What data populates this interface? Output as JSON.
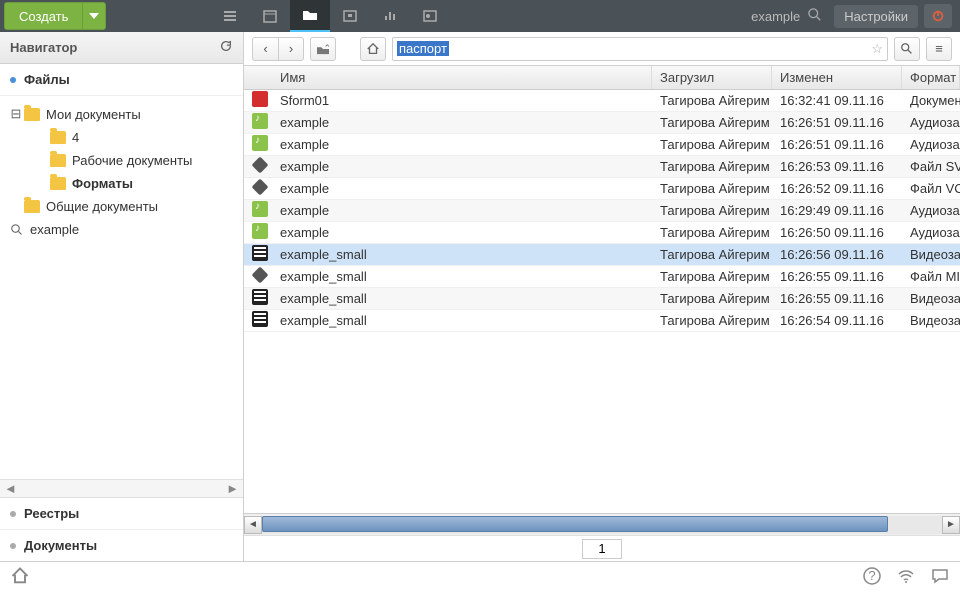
{
  "header": {
    "create_label": "Создать",
    "search_text": "example",
    "settings_label": "Настройки"
  },
  "sidebar": {
    "title": "Навигатор",
    "files_label": "Файлы",
    "tree": {
      "my_docs": "Мои документы",
      "item_4": "4",
      "working_docs": "Рабочие документы",
      "formats": "Форматы",
      "shared_docs": "Общие документы",
      "search_example": "example"
    },
    "registries_label": "Реестры",
    "documents_label": "Документы"
  },
  "toolbar": {
    "path_text": "паспорт"
  },
  "table": {
    "headers": {
      "name": "Имя",
      "uploader": "Загрузил",
      "modified": "Изменен",
      "type": "Формат"
    },
    "rows": [
      {
        "icon": "pdf",
        "name": "Sform01",
        "uploader": "Тагирова Айгерим",
        "modified": "16:32:41 09.11.16",
        "type": "Докумен",
        "selected": false
      },
      {
        "icon": "audio",
        "name": "example",
        "uploader": "Тагирова Айгерим",
        "modified": "16:26:51 09.11.16",
        "type": "Аудиоза",
        "selected": false
      },
      {
        "icon": "audio",
        "name": "example",
        "uploader": "Тагирова Айгерим",
        "modified": "16:26:51 09.11.16",
        "type": "Аудиоза",
        "selected": false
      },
      {
        "icon": "3d",
        "name": "example",
        "uploader": "Тагирова Айгерим",
        "modified": "16:26:53 09.11.16",
        "type": "Файл SV",
        "selected": false
      },
      {
        "icon": "3d",
        "name": "example",
        "uploader": "Тагирова Айгерим",
        "modified": "16:26:52 09.11.16",
        "type": "Файл VC",
        "selected": false
      },
      {
        "icon": "audio",
        "name": "example",
        "uploader": "Тагирова Айгерим",
        "modified": "16:29:49 09.11.16",
        "type": "Аудиоза",
        "selected": false
      },
      {
        "icon": "audio",
        "name": "example",
        "uploader": "Тагирова Айгерим",
        "modified": "16:26:50 09.11.16",
        "type": "Аудиоза",
        "selected": false
      },
      {
        "icon": "video",
        "name": "example_small",
        "uploader": "Тагирова Айгерим",
        "modified": "16:26:56 09.11.16",
        "type": "Видеоза",
        "selected": true
      },
      {
        "icon": "3d",
        "name": "example_small",
        "uploader": "Тагирова Айгерим",
        "modified": "16:26:55 09.11.16",
        "type": "Файл MI",
        "selected": false
      },
      {
        "icon": "video",
        "name": "example_small",
        "uploader": "Тагирова Айгерим",
        "modified": "16:26:55 09.11.16",
        "type": "Видеоза",
        "selected": false
      },
      {
        "icon": "video",
        "name": "example_small",
        "uploader": "Тагирова Айгерим",
        "modified": "16:26:54 09.11.16",
        "type": "Видеоза",
        "selected": false
      }
    ]
  },
  "pager": {
    "page": "1"
  }
}
